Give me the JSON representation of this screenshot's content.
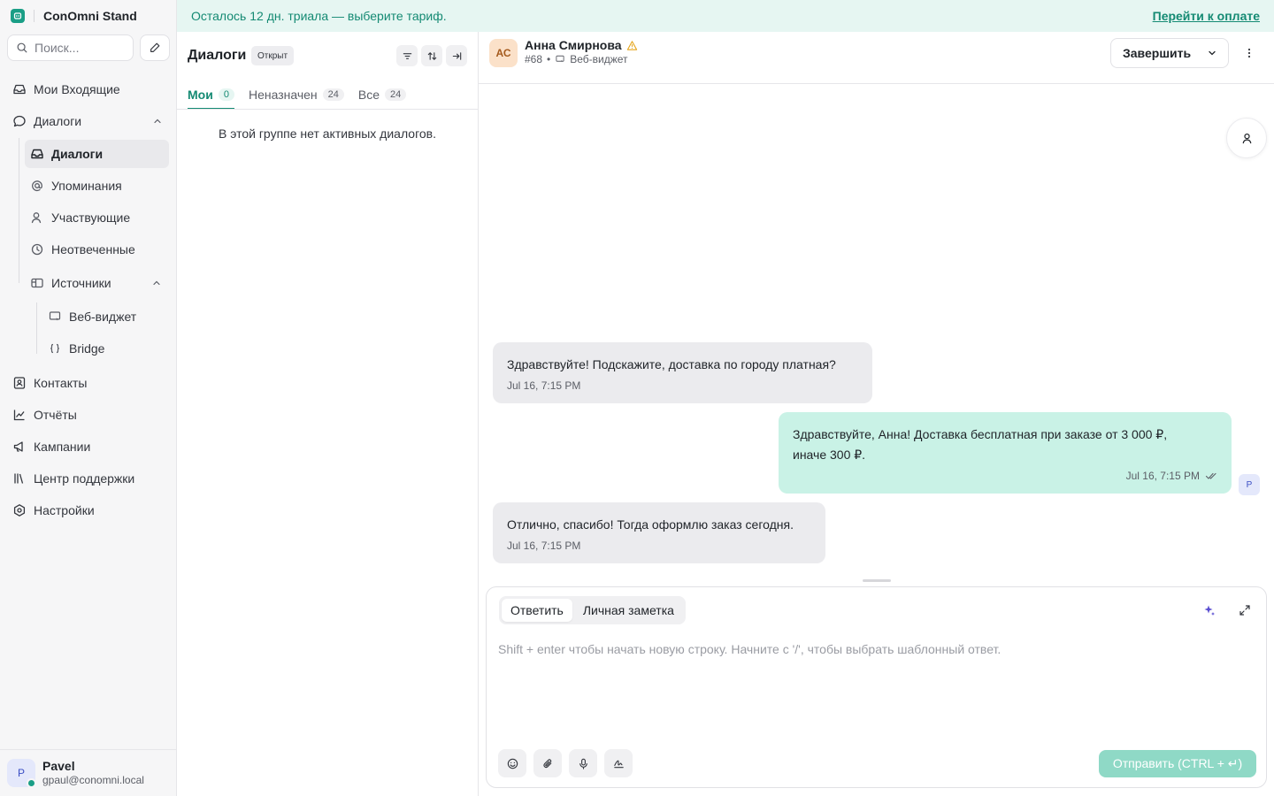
{
  "brand": {
    "name": "ConOmni Stand"
  },
  "search": {
    "placeholder": "Поиск..."
  },
  "sidebar": {
    "inbox": "Мои Входящие",
    "conversations": "Диалоги",
    "sub": {
      "conversations": "Диалоги",
      "mentions": "Упоминания",
      "participating": "Участвующие",
      "unattended": "Неотвеченные",
      "sources": "Источники",
      "web_widget": "Веб-виджет",
      "bridge": "Bridge"
    },
    "contacts": "Контакты",
    "reports": "Отчёты",
    "campaigns": "Кампании",
    "help_center": "Центр поддержки",
    "settings": "Настройки"
  },
  "user": {
    "initial": "P",
    "name": "Pavel",
    "email": "gpaul@conomni.local"
  },
  "banner": {
    "text": "Осталось 12 дн. триала — выберите тариф.",
    "link": "Перейти к оплате"
  },
  "list": {
    "title": "Диалоги",
    "status": "Открыт",
    "tabs": [
      {
        "label": "Мои",
        "count": "0"
      },
      {
        "label": "Неназначен",
        "count": "24"
      },
      {
        "label": "Все",
        "count": "24"
      }
    ],
    "empty": "В этой группе нет активных диалогов."
  },
  "conversation": {
    "contact_initials": "АС",
    "contact_name": "Анна Смирнова",
    "conv_id": "#68",
    "channel": "Веб-виджет",
    "resolve_label": "Завершить",
    "agent_initial": "P",
    "messages": [
      {
        "direction": "incoming",
        "text": "Здравствуйте! Подскажите, доставка по городу платная?",
        "time": "Jul 16, 7:15 PM"
      },
      {
        "direction": "outgoing",
        "text_line1": "Здравствуйте, Анна! Доставка бесплатная при заказе от 3 000 ₽,",
        "text_line2": "иначе 300 ₽.",
        "time": "Jul 16, 7:15 PM"
      },
      {
        "direction": "incoming",
        "text": "Отлично, спасибо! Тогда оформлю заказ сегодня.",
        "time": "Jul 16, 7:15 PM"
      }
    ]
  },
  "reply": {
    "tab_reply": "Ответить",
    "tab_note": "Личная заметка",
    "placeholder": "Shift + enter чтобы начать новую строку. Начните с '/', чтобы выбрать шаблонный ответ.",
    "send_label": "Отправить (CTRL + ↵)"
  },
  "colors": {
    "accent": "#148a73",
    "banner_bg": "#e6f6f2",
    "outgoing_bubble": "#c9f2e6",
    "incoming_bubble": "#ebebee",
    "send_disabled": "#8fd9c6"
  }
}
